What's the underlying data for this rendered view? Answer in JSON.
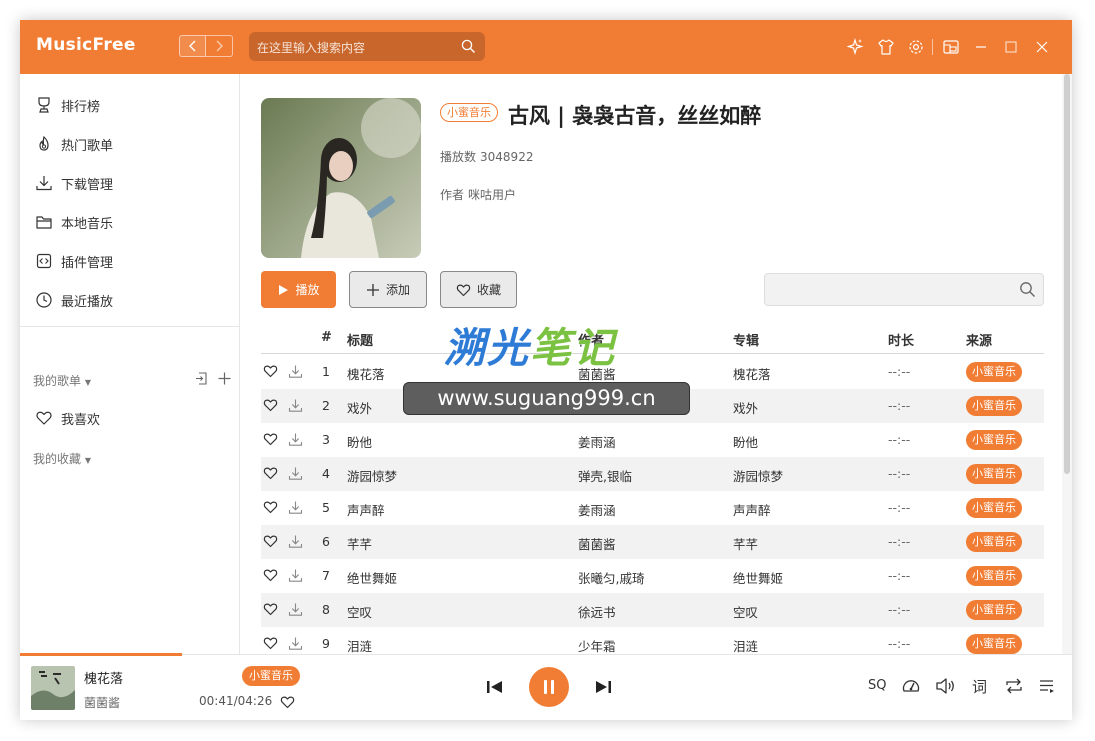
{
  "app": {
    "name": "MusicFree"
  },
  "colors": {
    "accent": "#f17d34",
    "text": "#333333",
    "row_alt": "#f2f2f2"
  },
  "header": {
    "search_placeholder": "在这里输入搜索内容",
    "icons": [
      "back-arrow-icon",
      "forward-arrow-icon",
      "search-icon",
      "sparkle-icon",
      "theme-shirt-icon",
      "settings-gear-icon",
      "mini-mode-icon",
      "minimize-icon",
      "maximize-icon",
      "close-icon"
    ]
  },
  "sidebar": {
    "items": [
      {
        "label": "排行榜",
        "icon": "trophy-icon"
      },
      {
        "label": "热门歌单",
        "icon": "fire-icon"
      },
      {
        "label": "下载管理",
        "icon": "download-icon"
      },
      {
        "label": "本地音乐",
        "icon": "folder-icon"
      },
      {
        "label": "插件管理",
        "icon": "plugin-icon"
      },
      {
        "label": "最近播放",
        "icon": "clock-icon"
      }
    ],
    "my_playlists": "我的歌单",
    "favorites": "我喜欢",
    "my_collections": "我的收藏"
  },
  "playlist": {
    "source": "小蜜音乐",
    "title": "古风 | 袅袅古音，丝丝如醉",
    "play_count_label": "播放数",
    "play_count": "3048922",
    "author_label": "作者",
    "author": "咪咕用户",
    "buttons": {
      "play": "播放",
      "add": "添加",
      "collect": "收藏"
    }
  },
  "table": {
    "headers": {
      "index": "#",
      "title": "标题",
      "artist": "作者",
      "album": "专辑",
      "duration": "时长",
      "source": "来源"
    },
    "rows": [
      {
        "index": "1",
        "title": "槐花落",
        "artist": "菌菌酱",
        "album": "槐花落",
        "duration": "--:--",
        "source": "小蜜音乐"
      },
      {
        "index": "2",
        "title": "戏外",
        "artist": "",
        "album": "戏外",
        "duration": "--:--",
        "source": "小蜜音乐"
      },
      {
        "index": "3",
        "title": "盼他",
        "artist": "姜雨涵",
        "album": "盼他",
        "duration": "--:--",
        "source": "小蜜音乐"
      },
      {
        "index": "4",
        "title": "游园惊梦",
        "artist": "弹壳,银临",
        "album": "游园惊梦",
        "duration": "--:--",
        "source": "小蜜音乐"
      },
      {
        "index": "5",
        "title": "声声醉",
        "artist": "姜雨涵",
        "album": "声声醉",
        "duration": "--:--",
        "source": "小蜜音乐"
      },
      {
        "index": "6",
        "title": "芊芊",
        "artist": "菌菌酱",
        "album": "芊芊",
        "duration": "--:--",
        "source": "小蜜音乐"
      },
      {
        "index": "7",
        "title": "绝世舞姬",
        "artist": "张曦匀,戚琦",
        "album": "绝世舞姬",
        "duration": "--:--",
        "source": "小蜜音乐"
      },
      {
        "index": "8",
        "title": "空叹",
        "artist": "徐远书",
        "album": "空叹",
        "duration": "--:--",
        "source": "小蜜音乐"
      },
      {
        "index": "9",
        "title": "泪涟",
        "artist": "少年霜",
        "album": "泪涟",
        "duration": "--:--",
        "source": "小蜜音乐"
      }
    ]
  },
  "watermark": {
    "title_blue": "溯光",
    "title_green": "笔记",
    "url": "www.suguang999.cn"
  },
  "player": {
    "title": "槐花落",
    "artist": "菌菌酱",
    "source": "小蜜音乐",
    "elapsed": "00:41",
    "total": "04:26",
    "progress": 0.154,
    "quality": "SQ",
    "lyric": "词"
  }
}
